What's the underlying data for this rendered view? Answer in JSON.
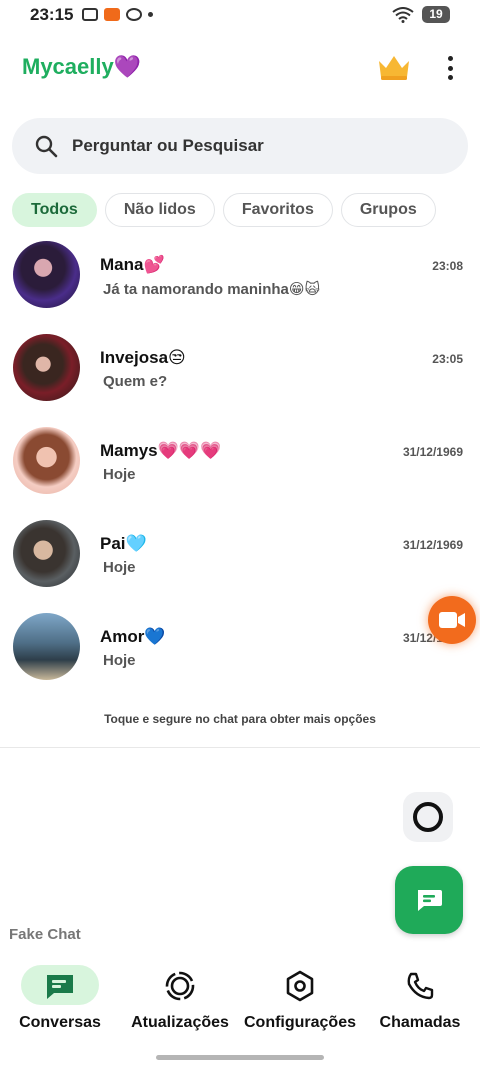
{
  "status_bar": {
    "time": "23:15",
    "battery": "19"
  },
  "header": {
    "title": "Mycaelly💜",
    "crown_icon": "crown-icon",
    "menu_icon": "more-vert-icon"
  },
  "search": {
    "placeholder": "Perguntar ou Pesquisar"
  },
  "filters": [
    {
      "label": "Todos",
      "active": true
    },
    {
      "label": "Não lidos",
      "active": false
    },
    {
      "label": "Favoritos",
      "active": false
    },
    {
      "label": "Grupos",
      "active": false
    }
  ],
  "chats": [
    {
      "name": "Mana💕",
      "time": "23:08",
      "message": "Já ta namorando maninha😁🙀"
    },
    {
      "name": "Invejosa😒",
      "time": "23:05",
      "message": "Quem e?"
    },
    {
      "name": "Mamys💗💗💗",
      "time": "31/12/1969",
      "message": "Hoje"
    },
    {
      "name": "Pai🩵",
      "time": "31/12/1969",
      "message": "Hoje"
    },
    {
      "name": "Amor💙",
      "time": "31/12/1969",
      "message": "Hoje"
    }
  ],
  "hint": "Toque e segure no chat para obter mais opções",
  "footer_label": "Fake Chat",
  "nav": [
    {
      "label": "Conversas",
      "icon": "chat-icon",
      "active": true
    },
    {
      "label": "Atualizações",
      "icon": "status-icon",
      "active": false
    },
    {
      "label": "Configurações",
      "icon": "settings-icon",
      "active": false
    },
    {
      "label": "Chamadas",
      "icon": "phone-icon",
      "active": false
    }
  ],
  "colors": {
    "brand_green": "#1fae5f",
    "accent_orange": "#f26b1d",
    "active_chip": "#d8f5dd"
  }
}
